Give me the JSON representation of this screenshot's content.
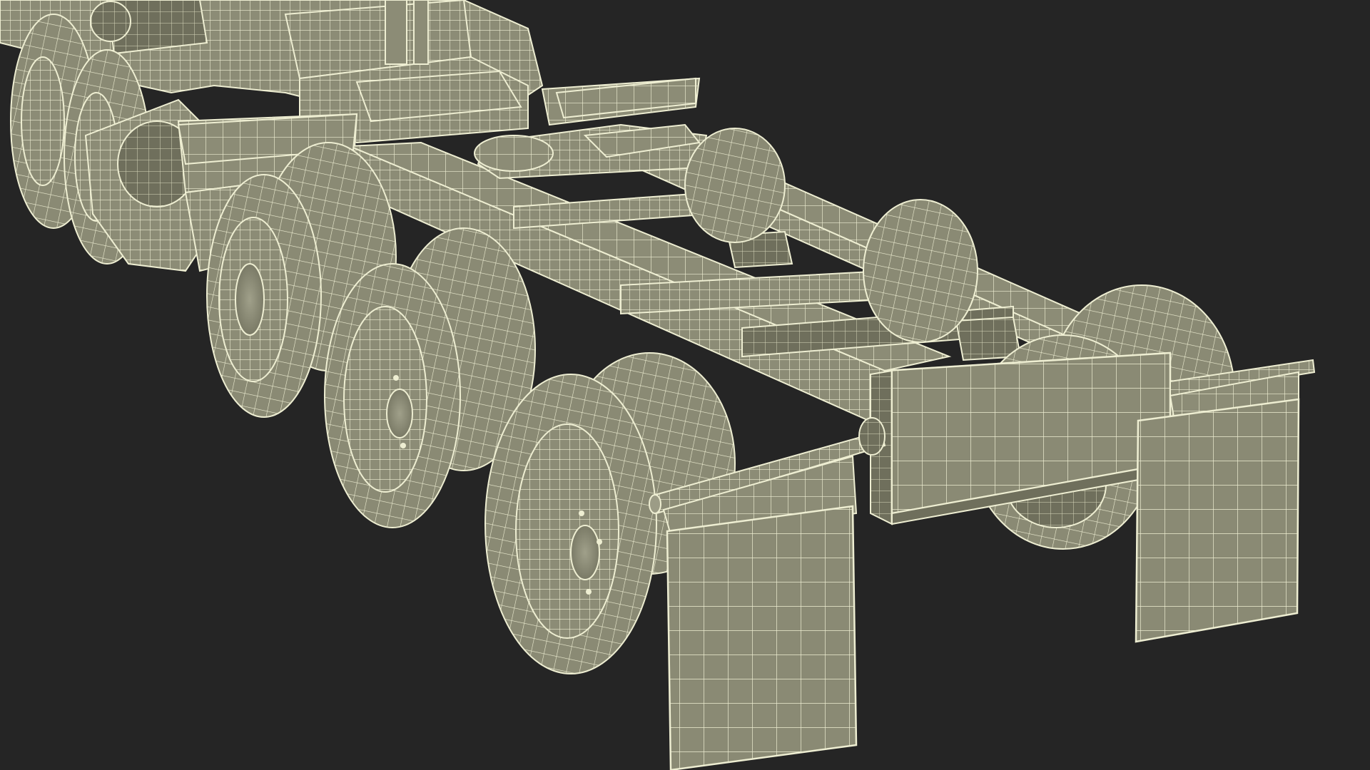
{
  "scene": {
    "background_color": "#252525",
    "model_fill": "#8c8c76",
    "model_fill_light": "#9c9c86",
    "model_fill_dark": "#73735f",
    "wire_color": "#eeeed2",
    "shadow_color": "#5e5e4c"
  },
  "objects": [
    {
      "name": "chassis-frame"
    },
    {
      "name": "wheel"
    },
    {
      "name": "mud-flap"
    },
    {
      "name": "rear-bumper"
    }
  ]
}
